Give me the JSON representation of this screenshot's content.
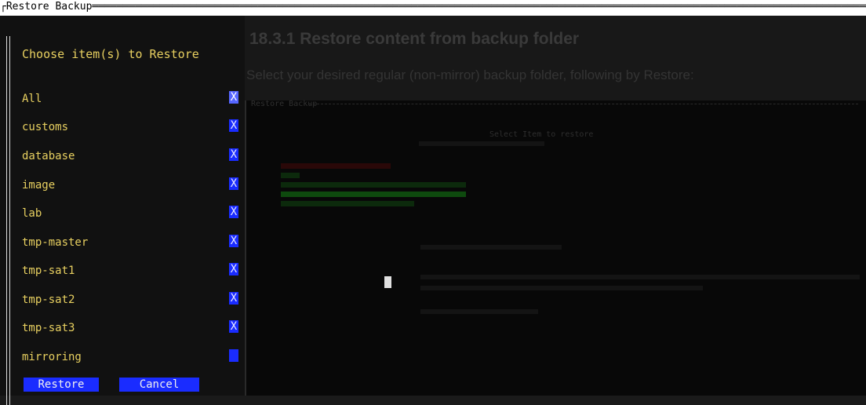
{
  "window": {
    "title": "Restore Backup"
  },
  "left": {
    "heading": "Choose item(s) to Restore",
    "items": [
      {
        "label": "All",
        "mark": "X"
      },
      {
        "label": "customs",
        "mark": "X"
      },
      {
        "label": "database",
        "mark": "X"
      },
      {
        "label": "image",
        "mark": "X"
      },
      {
        "label": "lab",
        "mark": "X"
      },
      {
        "label": "tmp-master",
        "mark": "X"
      },
      {
        "label": "tmp-sat1",
        "mark": "X"
      },
      {
        "label": "tmp-sat2",
        "mark": "X"
      },
      {
        "label": "tmp-sat3",
        "mark": "X"
      },
      {
        "label": "mirroring",
        "mark": ""
      }
    ],
    "buttons": {
      "restore": "Restore",
      "cancel": "Cancel"
    }
  },
  "doc": {
    "title": "18.3.1 Restore content from backup folder",
    "text": "Select your desired regular (non-mirror) backup folder, following by Restore:",
    "embedded": {
      "title": "Restore Backup",
      "select_label": "Select Item to restore"
    }
  },
  "colors": {
    "label": "#e8d060",
    "checkbox": "#1a2cff",
    "button": "#1a2cff",
    "background": "#1a1a1a"
  }
}
